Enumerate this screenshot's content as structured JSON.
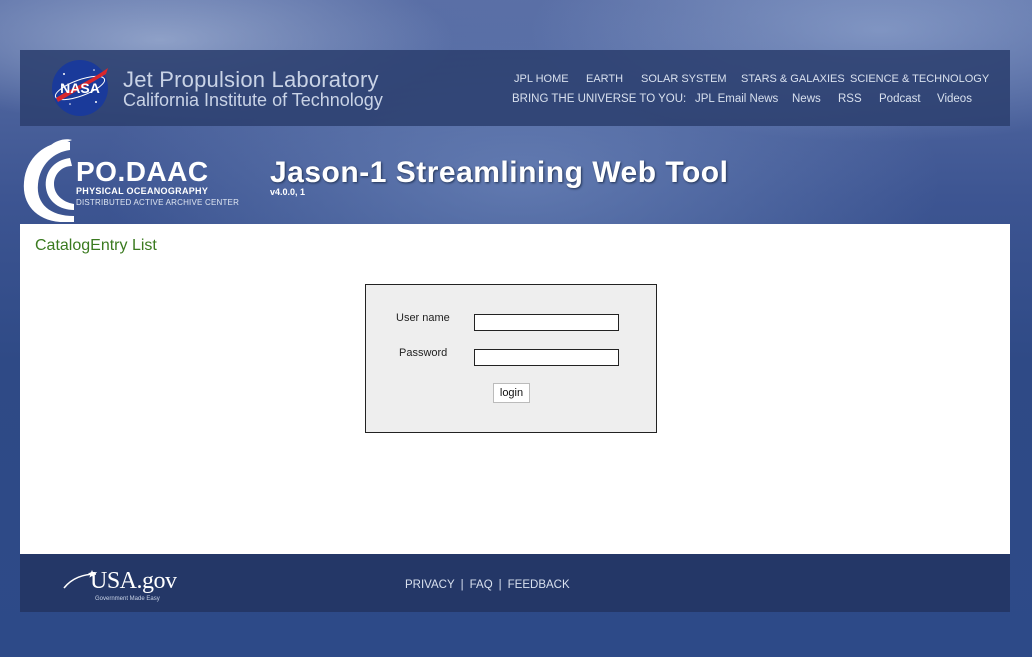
{
  "header": {
    "title": "Jet Propulsion Laboratory",
    "subtitle": "California Institute of Technology",
    "nasa_logo_text": "NASA",
    "nav_primary": [
      "JPL HOME",
      "EARTH",
      "SOLAR SYSTEM",
      "STARS & GALAXIES",
      "SCIENCE & TECHNOLOGY"
    ],
    "nav_secondary_label": "BRING THE UNIVERSE TO YOU:",
    "nav_secondary": [
      "JPL Email News",
      "News",
      "RSS",
      "Podcast",
      "Videos"
    ]
  },
  "banner": {
    "org_name": "PO.DAAC",
    "org_line1": "PHYSICAL OCEANOGRAPHY",
    "org_line2": "DISTRIBUTED ACTIVE ARCHIVE CENTER",
    "tool_title": "Jason-1 Streamlining Web Tool",
    "version": "v4.0.0, 1"
  },
  "main": {
    "page_title": "CatalogEntry List",
    "login": {
      "username_label": "User name",
      "username_value": "",
      "password_label": "Password",
      "password_value": "",
      "submit_label": "login"
    }
  },
  "footer": {
    "logo_text": "USA.gov",
    "logo_tagline": "Government Made Easy",
    "links": [
      "PRIVACY",
      "FAQ",
      "FEEDBACK"
    ]
  },
  "colors": {
    "header_bg": "#2c4070",
    "page_title": "#3a7a1f",
    "content_bg": "#ffffff",
    "login_box_bg": "#eeeeee"
  }
}
